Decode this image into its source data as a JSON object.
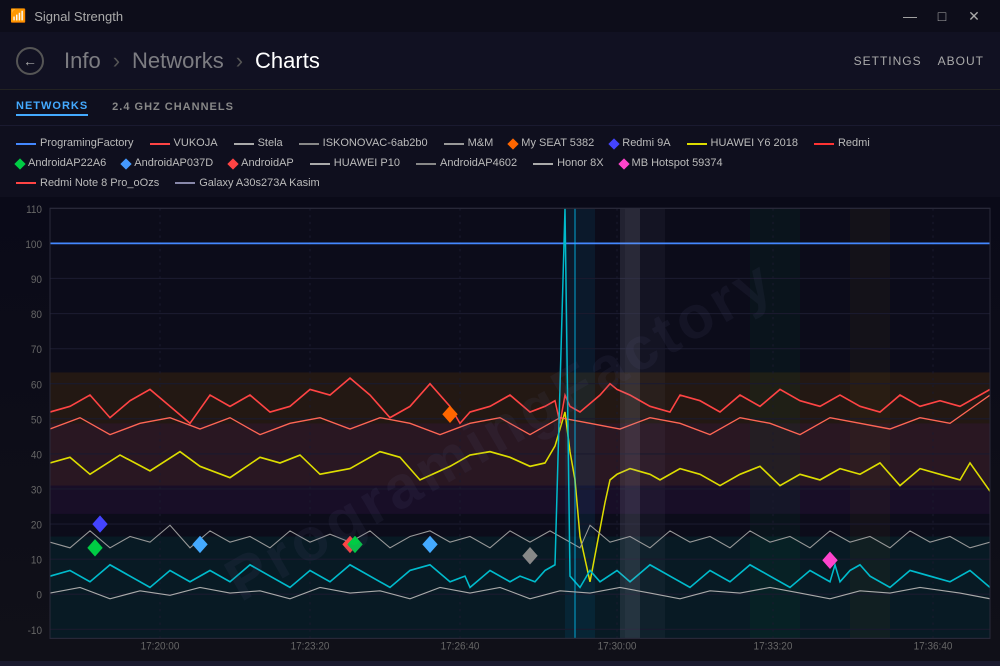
{
  "app": {
    "title": "Signal Strength"
  },
  "header": {
    "back_label": "←",
    "nav_info": "Info",
    "nav_networks": "Networks",
    "nav_charts": "Charts",
    "settings_label": "SETTINGS",
    "about_label": "ABOUT"
  },
  "subtabs": [
    {
      "id": "networks",
      "label": "NETWORKS",
      "active": true
    },
    {
      "id": "channels",
      "label": "2.4 GHZ CHANNELS",
      "active": false
    }
  ],
  "legend": {
    "items": [
      {
        "label": "ProgramingFactory",
        "color": "#4488ff",
        "type": "line"
      },
      {
        "label": "VUKOJA",
        "color": "#ff4444",
        "type": "line"
      },
      {
        "label": "Stela",
        "color": "#aaaaaa",
        "type": "line"
      },
      {
        "label": "ISKONOVAC-6ab2b0",
        "color": "#888888",
        "type": "line"
      },
      {
        "label": "M&M",
        "color": "#999999",
        "type": "line"
      },
      {
        "label": "My SEAT 5382",
        "color": "#ff6600",
        "type": "diamond",
        "diamond_color": "#ff6600"
      },
      {
        "label": "Redmi 9A",
        "color": "#4444ff",
        "type": "diamond",
        "diamond_color": "#4444ff"
      },
      {
        "label": "HUAWEI Y6 2018",
        "color": "#dddd00",
        "type": "line"
      },
      {
        "label": "Redmi",
        "color": "#ff3333",
        "type": "line"
      },
      {
        "label": "AndroidAP22A6",
        "color": "#00cc44",
        "type": "diamond",
        "diamond_color": "#00cc44"
      },
      {
        "label": "AndroidAP037D",
        "color": "#4499ff",
        "type": "diamond",
        "diamond_color": "#4499ff"
      },
      {
        "label": "AndroidAP",
        "color": "#ff4444",
        "type": "diamond",
        "diamond_color": "#ff4444"
      },
      {
        "label": "HUAWEI P10",
        "color": "#aaaaaa",
        "type": "line"
      },
      {
        "label": "AndroidAP4602",
        "color": "#888888",
        "type": "line"
      },
      {
        "label": "Honor 8X",
        "color": "#aaaaaa",
        "type": "line"
      },
      {
        "label": "MB Hotspot 59374",
        "color": "#ff44cc",
        "type": "diamond",
        "diamond_color": "#ff44cc"
      },
      {
        "label": "Redmi Note 8 Pro_oOzs",
        "color": "#ff4444",
        "type": "line"
      },
      {
        "label": "Galaxy A30s273A Kasim",
        "color": "#8888aa",
        "type": "line"
      }
    ]
  },
  "chart": {
    "y_labels": [
      "110",
      "100",
      "90",
      "80",
      "70",
      "60",
      "50",
      "40",
      "30",
      "20",
      "10",
      "0",
      "-10"
    ],
    "x_labels": [
      "17:20:00",
      "17:23:20",
      "17:26:40",
      "17:30:00",
      "17:33:20",
      "17:36:40"
    ],
    "accent_color": "#4af"
  },
  "titlebar": {
    "minimize_label": "—",
    "maximize_label": "□",
    "close_label": "✕"
  }
}
